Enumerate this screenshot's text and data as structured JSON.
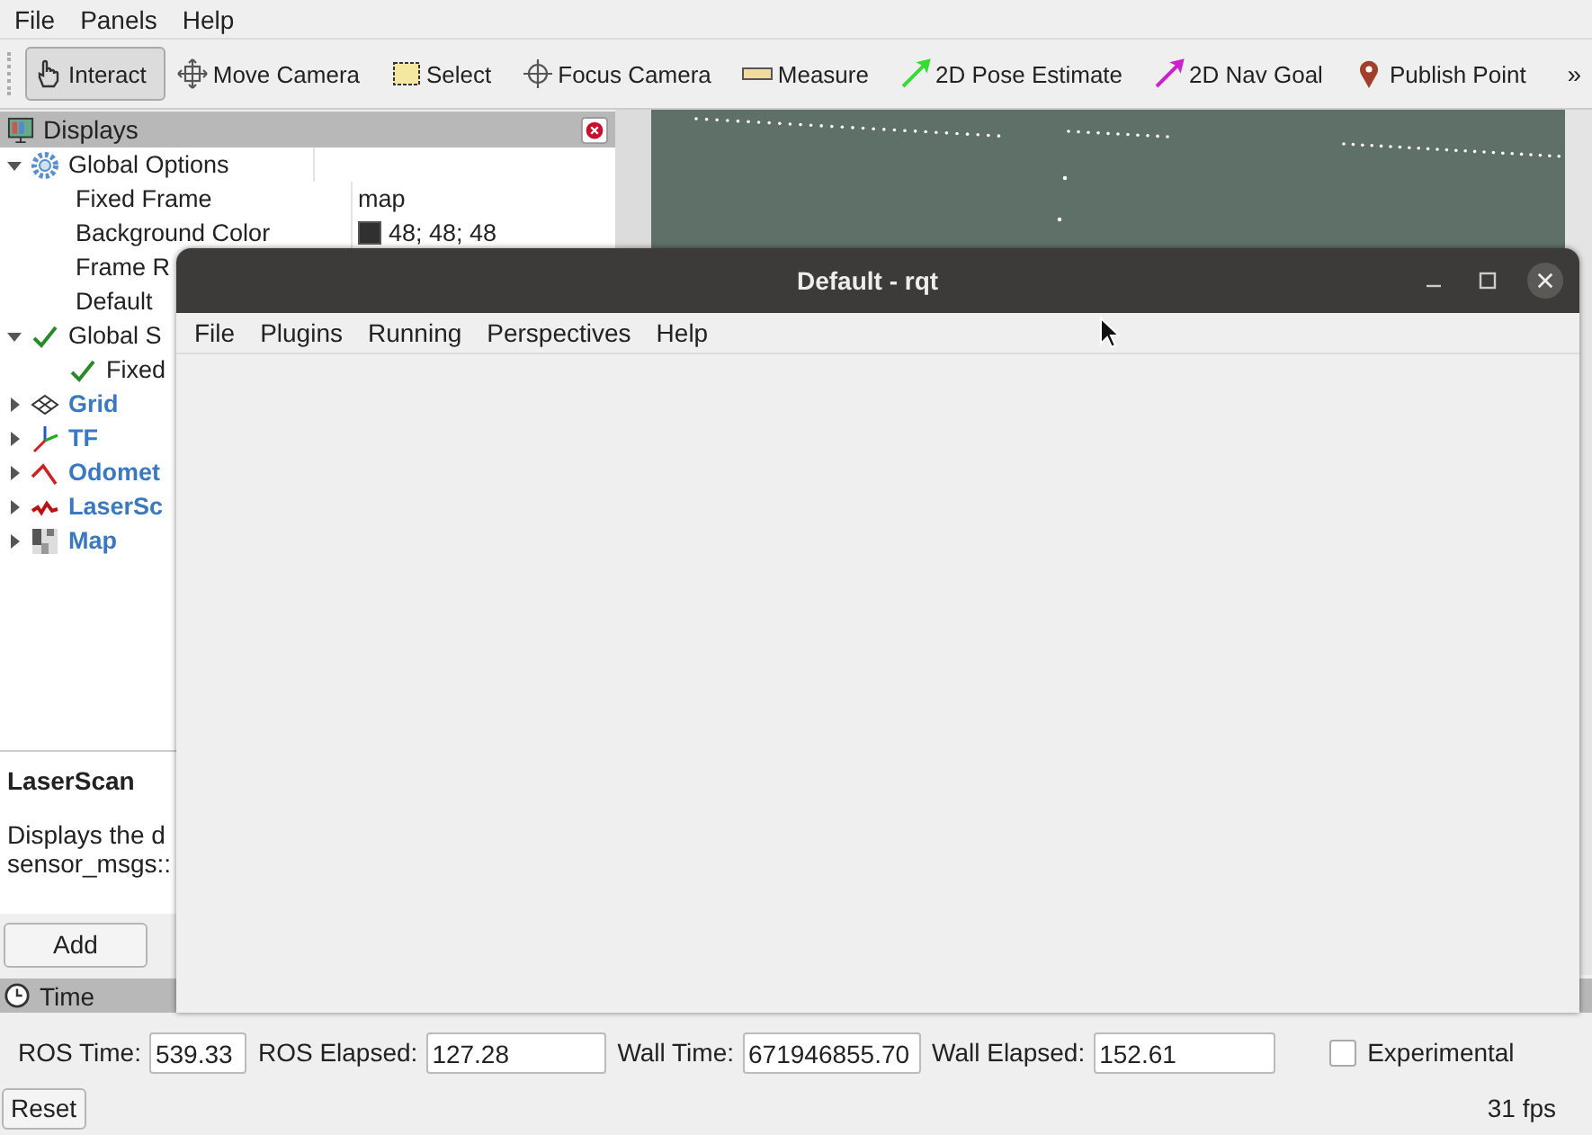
{
  "menu": [
    {
      "label": "File"
    },
    {
      "label": "Panels"
    },
    {
      "label": "Help"
    }
  ],
  "toolbar": {
    "tools": [
      {
        "label": "Interact",
        "selected": true
      },
      {
        "label": "Move Camera",
        "selected": false
      },
      {
        "label": "Select",
        "selected": false
      },
      {
        "label": "Focus Camera",
        "selected": false
      },
      {
        "label": "Measure",
        "selected": false
      },
      {
        "label": "2D Pose Estimate",
        "selected": false
      },
      {
        "label": "2D Nav Goal",
        "selected": false
      },
      {
        "label": "Publish Point",
        "selected": false
      }
    ],
    "overflow": "»"
  },
  "displays": {
    "title": "Displays",
    "tree": [
      {
        "kind": "group",
        "name": "Global Options",
        "expanded": true,
        "children": [
          {
            "kind": "property",
            "name": "Fixed Frame",
            "value": "map"
          },
          {
            "kind": "property",
            "name": "Background Color",
            "value": "48; 48; 48"
          },
          {
            "kind": "property",
            "name": "Frame R"
          },
          {
            "kind": "property",
            "name": "Default"
          }
        ]
      },
      {
        "kind": "status",
        "name": "Global S",
        "expanded": true,
        "children": [
          {
            "kind": "status",
            "name": "Fixed"
          }
        ]
      },
      {
        "kind": "display",
        "name": "Grid",
        "expanded": false
      },
      {
        "kind": "display",
        "name": "TF",
        "expanded": false
      },
      {
        "kind": "display",
        "name": "Odomet",
        "expanded": false
      },
      {
        "kind": "display",
        "name": "LaserSc",
        "expanded": false
      },
      {
        "kind": "display",
        "name": "Map",
        "expanded": false
      }
    ],
    "description": {
      "title": "LaserScan",
      "lines": [
        "Displays the d",
        "sensor_msgs::"
      ]
    },
    "buttons": [
      {
        "label": "Add"
      }
    ]
  },
  "time": {
    "title": "Time",
    "fields": [
      {
        "label": "ROS Time:",
        "value": "539.33"
      },
      {
        "label": "ROS Elapsed:",
        "value": "127.28"
      },
      {
        "label": "Wall Time:",
        "value": "671946855.70"
      },
      {
        "label": "Wall Elapsed:",
        "value": "152.61"
      }
    ],
    "experimental": {
      "label": "Experimental",
      "checked": false
    },
    "reset": "Reset",
    "fps": "31 fps"
  },
  "rqt": {
    "title": "Default - rqt",
    "menu": [
      {
        "label": "File"
      },
      {
        "label": "Plugins"
      },
      {
        "label": "Running"
      },
      {
        "label": "Perspectives"
      },
      {
        "label": "Help"
      }
    ]
  }
}
